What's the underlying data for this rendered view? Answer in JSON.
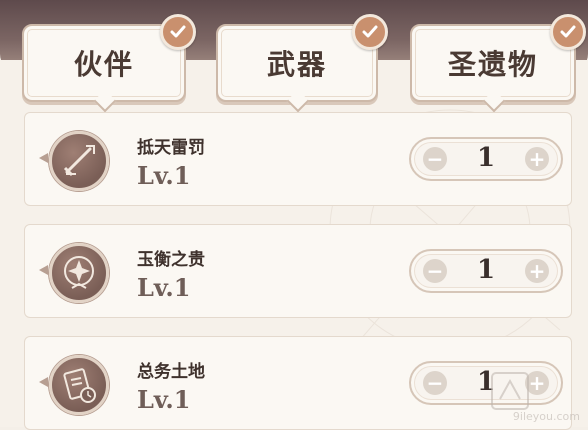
{
  "tabs": [
    {
      "label": "伙伴",
      "checked": true
    },
    {
      "label": "武器",
      "checked": true
    },
    {
      "label": "圣遗物",
      "checked": true
    }
  ],
  "items": [
    {
      "name": "抵天雷罚",
      "level": "Lv.1",
      "quantity": "1",
      "icon": "sword-emblem-icon"
    },
    {
      "name": "玉衡之贵",
      "level": "Lv.1",
      "quantity": "1",
      "icon": "star-compass-emblem-icon"
    },
    {
      "name": "总务土地",
      "level": "Lv.1",
      "quantity": "1",
      "icon": "document-clock-emblem-icon"
    }
  ],
  "stepper": {
    "minus": "−",
    "plus": "+"
  },
  "watermark": {
    "domain": "9ileyou.com"
  },
  "colors": {
    "accent": "#c9906e",
    "text_dark": "#3f322d",
    "panel_bg": "#f6f1ea",
    "emblem": "#7a5e56"
  }
}
